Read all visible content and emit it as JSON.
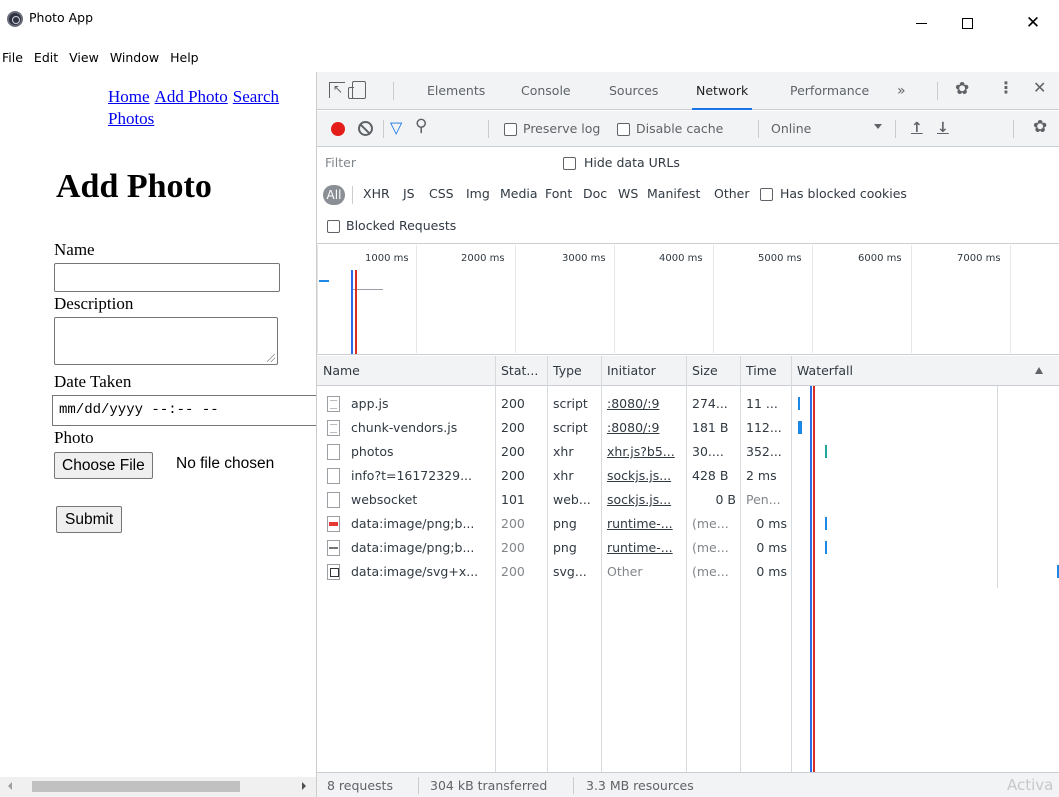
{
  "window": {
    "title": "Photo App"
  },
  "menu": [
    "File",
    "Edit",
    "View",
    "Window",
    "Help"
  ],
  "page": {
    "nav": [
      "Home",
      "Add Photo",
      "Search Photos"
    ],
    "heading": "Add Photo",
    "fields": {
      "name_label": "Name",
      "description_label": "Description",
      "date_label": "Date Taken",
      "date_placeholder": "mm/dd/yyyy --:-- --",
      "photo_label": "Photo",
      "choose_file": "Choose File",
      "no_file": "No file chosen",
      "submit": "Submit"
    }
  },
  "devtools": {
    "tabs": [
      "Elements",
      "Console",
      "Sources",
      "Network",
      "Performance"
    ],
    "active_tab": "Network",
    "more_tabs": "»",
    "toolbar": {
      "preserve_log": "Preserve log",
      "disable_cache": "Disable cache",
      "throttling": "Online"
    },
    "filter": {
      "placeholder": "Filter",
      "hide_data_urls": "Hide data URLs",
      "types": [
        "All",
        "XHR",
        "JS",
        "CSS",
        "Img",
        "Media",
        "Font",
        "Doc",
        "WS",
        "Manifest",
        "Other"
      ],
      "has_blocked_cookies": "Has blocked cookies",
      "blocked_requests": "Blocked Requests"
    },
    "overview_ticks": [
      "1000 ms",
      "2000 ms",
      "3000 ms",
      "4000 ms",
      "5000 ms",
      "6000 ms",
      "7000 ms"
    ],
    "columns": [
      "Name",
      "Stat...",
      "Type",
      "Initiator",
      "Size",
      "Time",
      "Waterfall"
    ],
    "rows": [
      {
        "name": "app.js",
        "status": "200",
        "type": "script",
        "initiator": ":8080/:9",
        "size": "274...",
        "time": "11 ...",
        "icon": "document-icon"
      },
      {
        "name": "chunk-vendors.js",
        "status": "200",
        "type": "script",
        "initiator": ":8080/:9",
        "size": "181 B",
        "time": "112...",
        "icon": "document-icon"
      },
      {
        "name": "photos",
        "status": "200",
        "type": "xhr",
        "initiator": "xhr.js?b5...",
        "size": "30....",
        "time": "352...",
        "icon": "blank-file-icon"
      },
      {
        "name": "info?t=16172329...",
        "status": "200",
        "type": "xhr",
        "initiator": "sockjs.js...",
        "size": "428 B",
        "time": "2 ms",
        "icon": "blank-file-icon"
      },
      {
        "name": "websocket",
        "status": "101",
        "type": "web...",
        "initiator": "sockjs.js...",
        "size": "0 B",
        "time": "Pen...",
        "icon": "blank-file-icon"
      },
      {
        "name": "data:image/png;b...",
        "status": "200",
        "type": "png",
        "initiator": "runtime-...",
        "size": "(me...",
        "time": "0 ms",
        "icon": "image-red-icon"
      },
      {
        "name": "data:image/png;b...",
        "status": "200",
        "type": "png",
        "initiator": "runtime-...",
        "size": "(me...",
        "time": "0 ms",
        "icon": "image-gray-icon"
      },
      {
        "name": "data:image/svg+x...",
        "status": "200",
        "type": "svg...",
        "initiator": "Other",
        "size": "(me...",
        "time": "0 ms",
        "icon": "svg-file-icon"
      }
    ],
    "status_bar": {
      "requests": "8 requests",
      "transferred": "304 kB transferred",
      "resources": "3.3 MB resources"
    },
    "watermark": "Activa",
    "colors": {
      "record": "#e51d1a",
      "accent": "#1a73e8",
      "waterfall_bar": "#1e88e5",
      "dom_line": "#d93025"
    }
  }
}
